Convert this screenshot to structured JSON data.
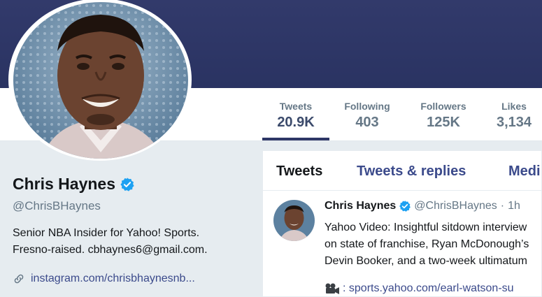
{
  "stats": [
    {
      "label": "Tweets",
      "value": "20.9K",
      "active": true
    },
    {
      "label": "Following",
      "value": "403",
      "active": false
    },
    {
      "label": "Followers",
      "value": "125K",
      "active": false
    },
    {
      "label": "Likes",
      "value": "3,134",
      "active": false
    }
  ],
  "profile": {
    "name": "Chris Haynes",
    "handle": "@ChrisBHaynes",
    "bio_line1": "Senior NBA Insider for Yahoo! Sports.",
    "bio_line2": "Fresno-raised. cbhaynes6@gmail.com.",
    "link": "instagram.com/chrisbhaynesnb..."
  },
  "tabs": [
    "Tweets",
    "Tweets & replies",
    "Medi"
  ],
  "tweet": {
    "name": "Chris Haynes",
    "handle": "@ChrisBHaynes",
    "separator": "·",
    "time": "1h",
    "line1": "Yahoo Video: Insightful sitdown interview",
    "line2": "on state of franchise, Ryan McDonough’s",
    "line3": "Devin Booker, and a two-week ultimatum",
    "link": ": sports.yahoo.com/earl-watson-su"
  },
  "colors": {
    "banner": "#2d3666",
    "verified": "#1da1f2",
    "link": "#3b4a8b"
  },
  "icons": {
    "verified": "verified-badge-icon",
    "link": "link-icon",
    "camera": "movie-camera-icon"
  }
}
